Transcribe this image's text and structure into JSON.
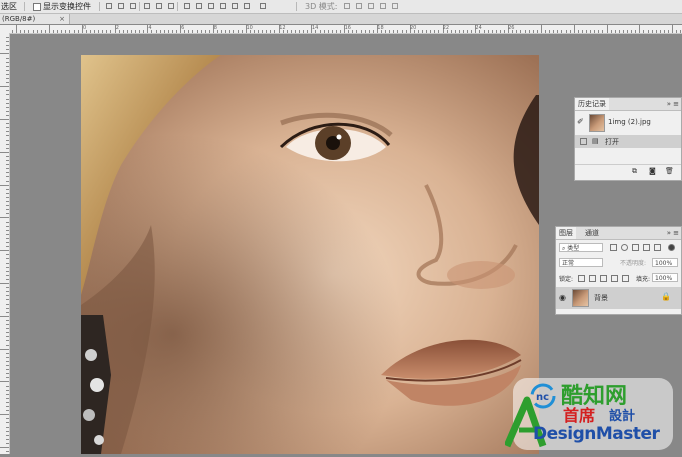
{
  "options_bar": {
    "left_label": "选区",
    "checkbox_label": "显示变换控件",
    "mode_label": "3D 模式:"
  },
  "document_tab": {
    "title": "(RGB/8#)",
    "close": "×"
  },
  "ruler": {
    "labels": [
      "0",
      "2",
      "4",
      "6",
      "8",
      "10",
      "12",
      "14",
      "16",
      "18",
      "20",
      "22",
      "24",
      "26"
    ]
  },
  "history_panel": {
    "title": "历史记录",
    "menu": "»",
    "snapshot_name": "1img (2).jpg",
    "step_name": "打开"
  },
  "layers_panel": {
    "tab_layers": "图层",
    "tab_channels": "通道",
    "menu": "»",
    "filter_kind": "类型",
    "blend_mode": "正常",
    "opacity_label": "不透明度:",
    "opacity_value": "100%",
    "lock_label": "锁定:",
    "fill_label": "填充:",
    "fill_value": "100%",
    "layer_name": "背景"
  },
  "watermark": {
    "brand_cn": "酷知网",
    "sub_cn": "首席",
    "sub_cn2": "設計",
    "brand_en": "DesignMaster"
  },
  "colors": {
    "workspace": "#888888",
    "panel": "#f0f0f0",
    "watermark_green": "#2e9e2e",
    "watermark_red": "#d42020",
    "watermark_blue": "#1f4fa8"
  }
}
